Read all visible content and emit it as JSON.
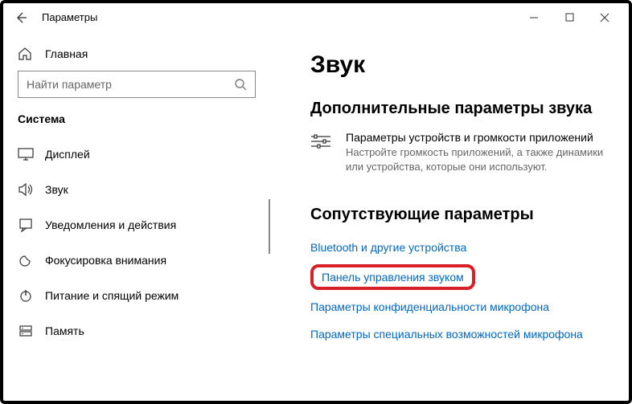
{
  "window": {
    "title": "Параметры"
  },
  "sidebar": {
    "home_label": "Главная",
    "search_placeholder": "Найти параметр",
    "section": "Система",
    "items": [
      {
        "label": "Дисплей"
      },
      {
        "label": "Звук"
      },
      {
        "label": "Уведомления и действия"
      },
      {
        "label": "Фокусировка внимания"
      },
      {
        "label": "Питание и спящий режим"
      },
      {
        "label": "Память"
      }
    ]
  },
  "main": {
    "title": "Звук",
    "section1_title": "Дополнительные параметры звука",
    "app_volume": {
      "label": "Параметры устройств и громкости приложений",
      "desc": "Настройте громкость приложений, а также динамики или устройства, которые они используют."
    },
    "section2_title": "Сопутствующие параметры",
    "links": {
      "bluetooth": "Bluetooth и другие устройства",
      "sound_panel": "Панель управления звуком",
      "mic_privacy": "Параметры конфиденциальности микрофона",
      "mic_access": "Параметры специальных возможностей микрофона"
    }
  }
}
